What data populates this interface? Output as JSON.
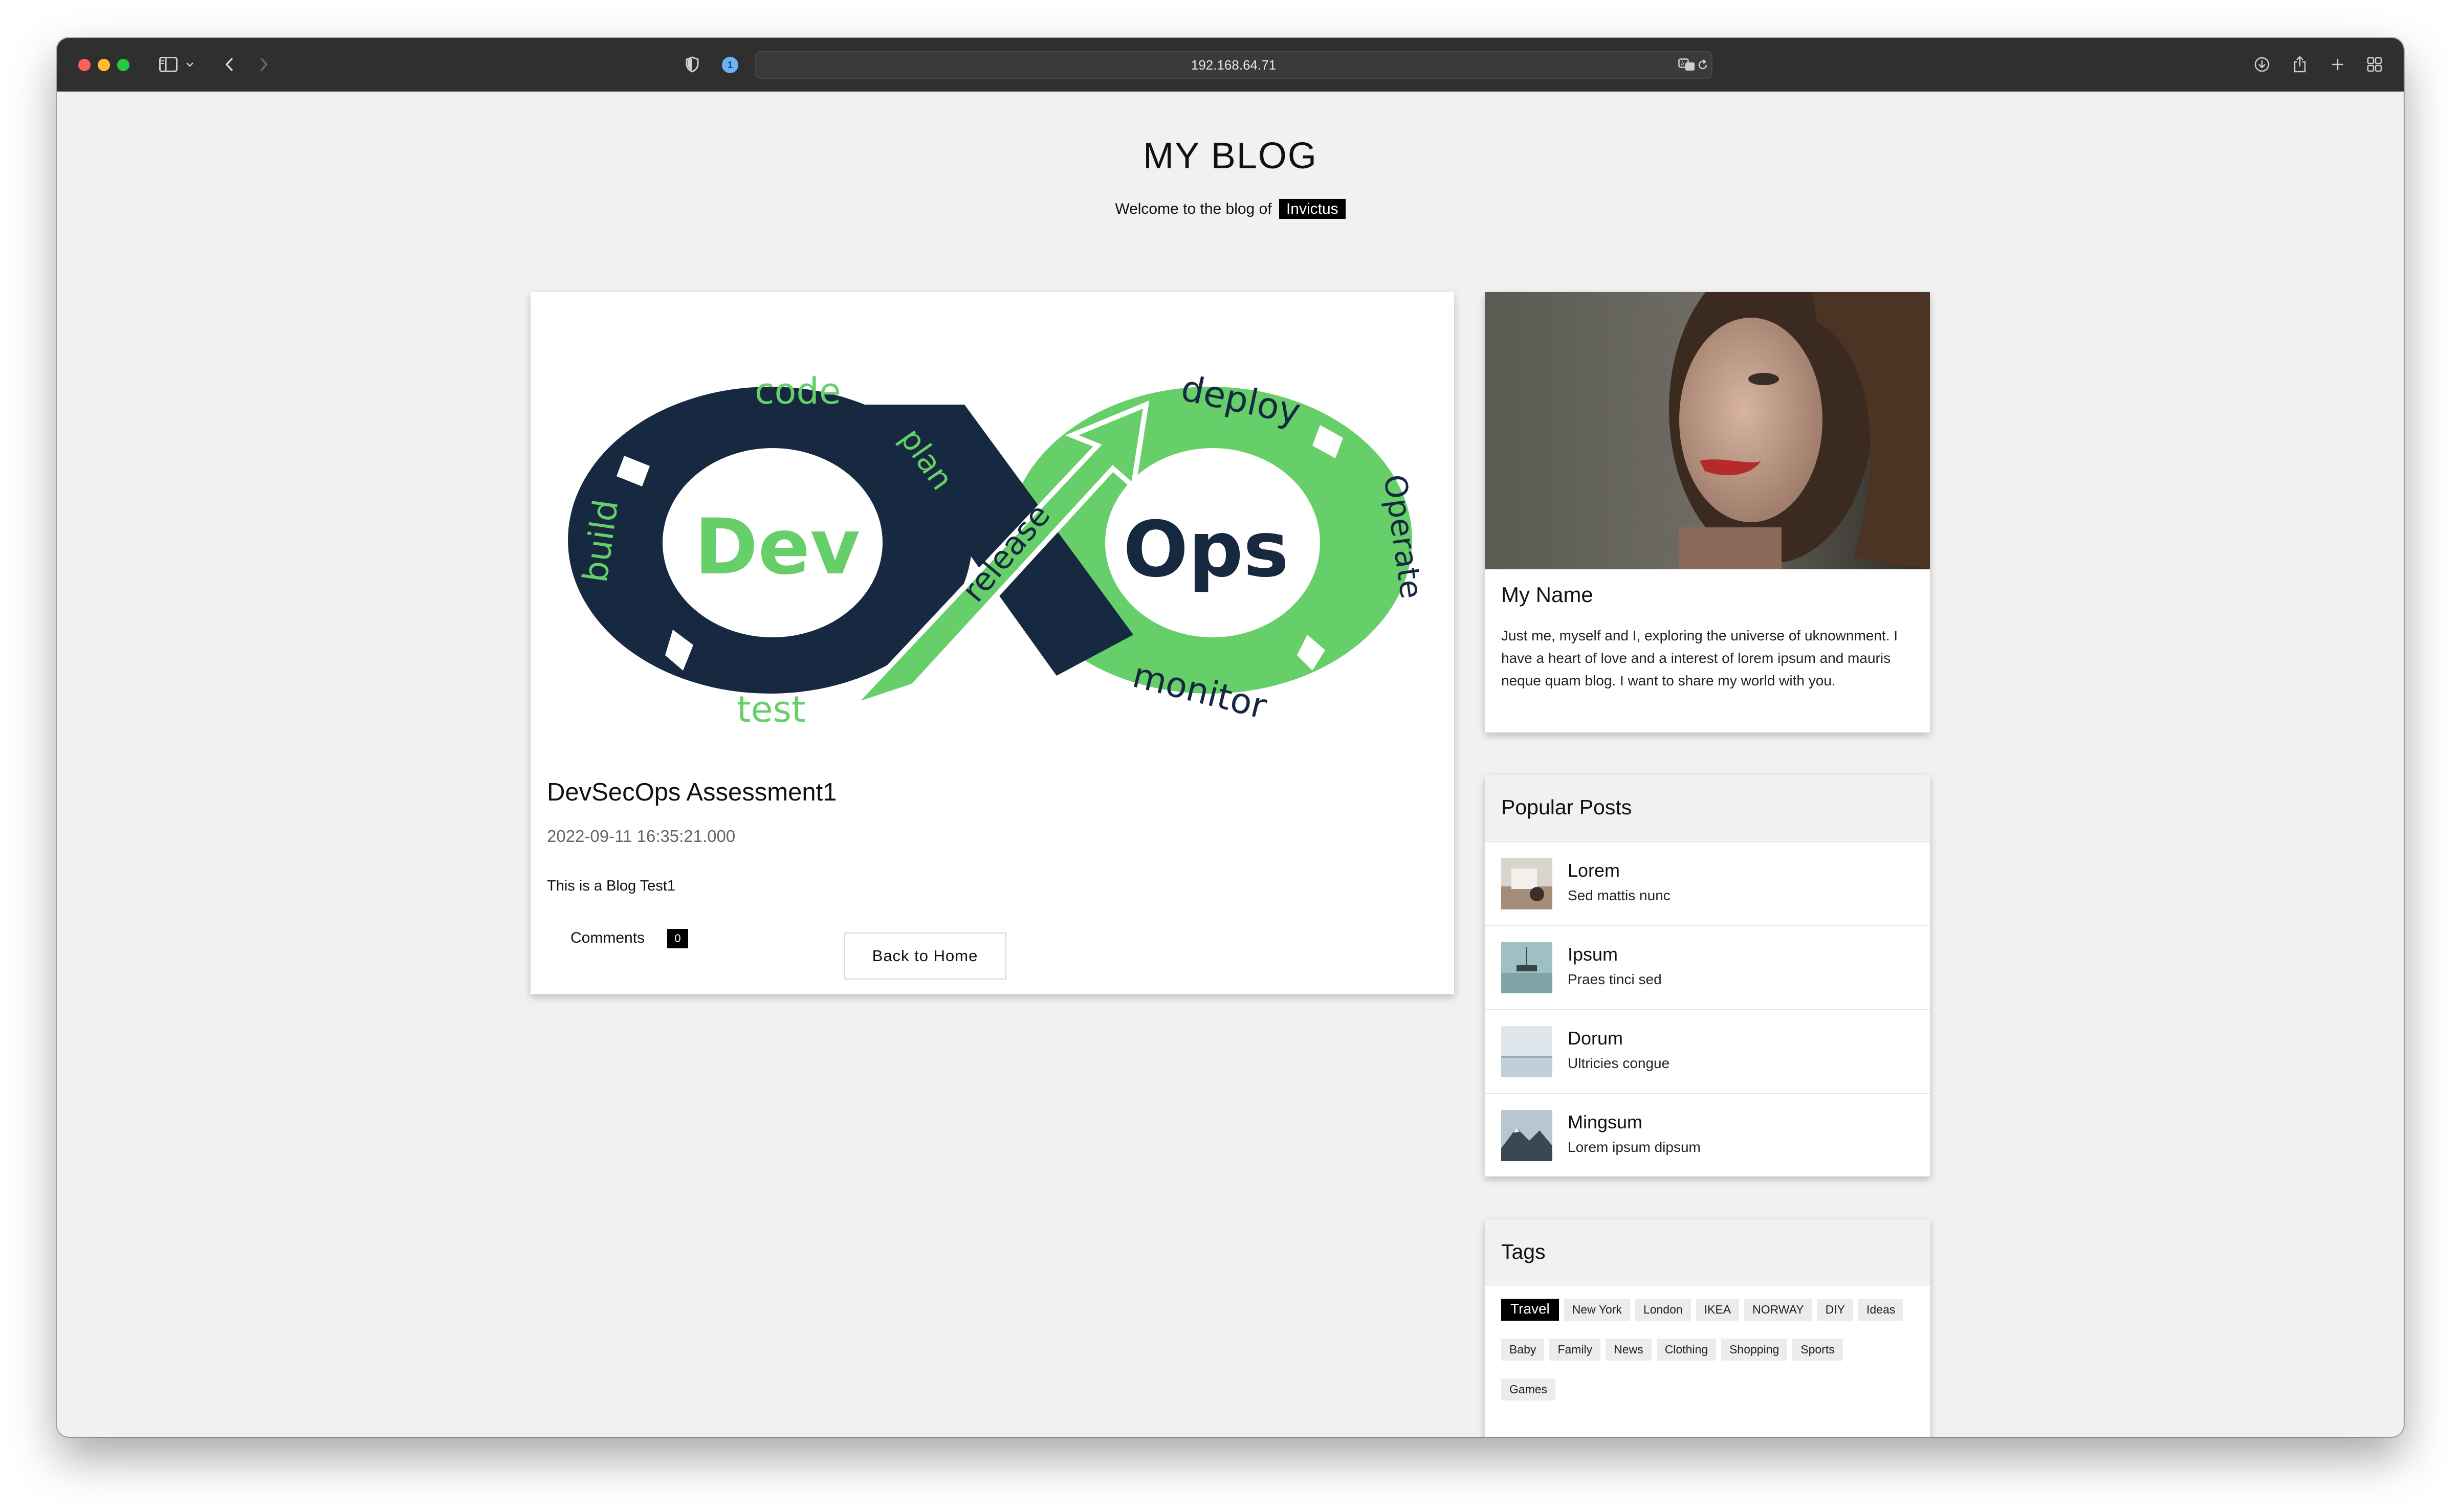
{
  "browser": {
    "url": "192.168.64.71",
    "badge": "1",
    "colors": {
      "chrome": "#2f2f2f",
      "close": "#fe5f57",
      "minimize": "#febc2e",
      "zoom": "#28c840"
    }
  },
  "header": {
    "title": "MY BLOG",
    "welcome_text": "Welcome to the blog of",
    "author": "Invictus"
  },
  "post": {
    "image_words": {
      "code": "code",
      "build": "build",
      "test": "test",
      "plan": "plan",
      "dev": "Dev",
      "release": "release",
      "deploy": "deploy",
      "operate": "Operate",
      "monitor": "monitor",
      "ops": "Ops"
    },
    "title": "DevSecOps Assessment1",
    "date": "2022-09-11 16:35:21.000",
    "body": "This is a Blog Test1",
    "comments_label": "Comments",
    "comments_count": "0",
    "back_label": "Back to Home",
    "colors": {
      "navy": "#172940",
      "green": "#66cf6a"
    }
  },
  "profile": {
    "name": "My Name",
    "bio": "Just me, myself and I, exploring the universe of uknownment. I have a heart of love and a interest of lorem ipsum and mauris neque quam blog. I want to share my world with you."
  },
  "popular": {
    "heading": "Popular Posts",
    "items": [
      {
        "title": "Lorem",
        "subtitle": "Sed mattis nunc"
      },
      {
        "title": "Ipsum",
        "subtitle": "Praes tinci sed"
      },
      {
        "title": "Dorum",
        "subtitle": "Ultricies congue"
      },
      {
        "title": "Mingsum",
        "subtitle": "Lorem ipsum dipsum"
      }
    ]
  },
  "tags": {
    "heading": "Tags",
    "row1": [
      "Travel",
      "New York",
      "London",
      "IKEA",
      "NORWAY",
      "DIY",
      "Ideas"
    ],
    "row2": [
      "Baby",
      "Family",
      "News",
      "Clothing",
      "Shopping",
      "Sports"
    ],
    "row3": [
      "Games"
    ],
    "active": "Travel"
  }
}
